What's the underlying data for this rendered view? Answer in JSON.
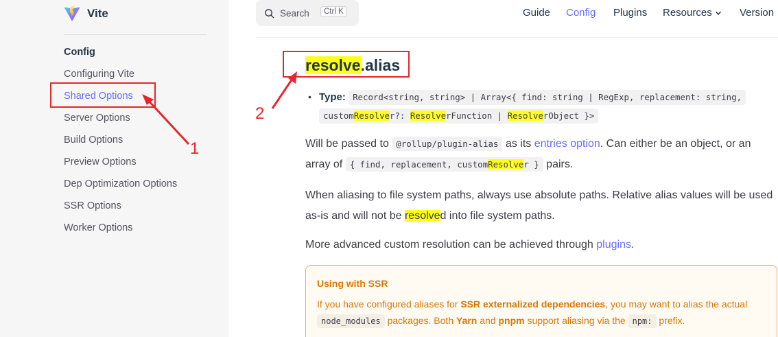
{
  "brand": {
    "name": "Vite"
  },
  "sidebar": {
    "section_title": "Config",
    "items": [
      {
        "label": "Configuring Vite"
      },
      {
        "label": "Shared Options"
      },
      {
        "label": "Server Options"
      },
      {
        "label": "Build Options"
      },
      {
        "label": "Preview Options"
      },
      {
        "label": "Dep Optimization Options"
      },
      {
        "label": "SSR Options"
      },
      {
        "label": "Worker Options"
      }
    ]
  },
  "search": {
    "label": "Search",
    "shortcut": "Ctrl K"
  },
  "nav": {
    "guide": "Guide",
    "config": "Config",
    "plugins": "Plugins",
    "resources": "Resources",
    "version": "Version"
  },
  "heading": {
    "highlight": "resolve",
    "rest": ".alias"
  },
  "type": {
    "label": "Type:",
    "line1": "Record<string, string> | Array<{ find: string | RegExp, replacement: string,",
    "line2_a": "custom",
    "line2_hl1": "Resolve",
    "line2_b": "r?: ",
    "line2_hl2": "Resolve",
    "line2_c": "rFunction | ",
    "line2_hl3": "Resolve",
    "line2_d": "rObject }>"
  },
  "para1": {
    "a": "Will be passed to ",
    "code1": "@rollup/plugin-alias",
    "b": " as its ",
    "link": "entries option",
    "c": ". Can either be an object, or an array of ",
    "code2_a": "{ find, replacement, custom",
    "code2_hl": "Resolve",
    "code2_b": "r }",
    "d": " pairs."
  },
  "para2": {
    "a": "When aliasing to file system paths, always use absolute paths. Relative alias values will be used as-is and will not be ",
    "hl": "resolve",
    "b": "d into file system paths."
  },
  "para3": {
    "a": "More advanced custom resolution can be achieved through ",
    "link": "plugins",
    "b": "."
  },
  "ssr": {
    "title": "Using with SSR",
    "a": "If you have configured aliases for ",
    "b1": "SSR externalized dependencies",
    "b": ", you may want to alias the actual ",
    "code1": "node_modules",
    "c": " packages. Both ",
    "b2": "Yarn",
    "d": " and ",
    "b3": "pnpm",
    "e": " support aliasing via the ",
    "code2": "npm:",
    "f": " prefix."
  },
  "annotations": {
    "one": "1",
    "two": "2"
  },
  "colors": {
    "accent": "#646cff",
    "highlight": "#ffff1e",
    "annotation": "#e5262c",
    "warning": "#d97706"
  }
}
